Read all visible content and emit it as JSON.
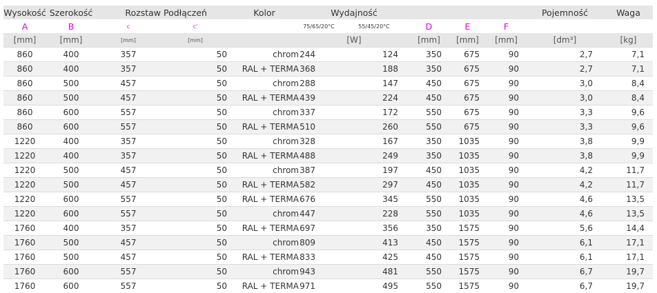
{
  "headers": {
    "row1": {
      "wysokosc": "Wysokość",
      "szerokosc": "Szerokość",
      "rozstaw": "Rozstaw",
      "podlaczen": "Podłączeń",
      "kolor": "Kolor",
      "wydajnosc": "Wydajność",
      "pojemnosc": "Pojemność",
      "waga": "Waga"
    },
    "row2": {
      "a": "A",
      "b": "B",
      "c": "c",
      "c2": "c'",
      "t1": "75/65/20°C",
      "t2": "55/45/20°C",
      "d": "D",
      "e": "E",
      "f": "F"
    },
    "row3": {
      "a": "[mm]",
      "b": "[mm]",
      "c": "[mm]",
      "c2": "[mm]",
      "w": "[W]",
      "d": "[mm]",
      "e": "[mm]",
      "f": "[mm]",
      "poj": "[dm³]",
      "waga": "[kg]"
    }
  },
  "columns": [
    "A",
    "B",
    "C",
    "C'",
    "Kolor",
    "75/65/20°C",
    "55/45/20°C",
    "D",
    "E",
    "F",
    "Pojemność",
    "Waga"
  ],
  "rows": [
    [
      "860",
      "400",
      "357",
      "50",
      "chrom",
      "244",
      "124",
      "350",
      "675",
      "90",
      "2,7",
      "7,1"
    ],
    [
      "860",
      "400",
      "357",
      "50",
      "RAL + TERMA",
      "368",
      "188",
      "350",
      "675",
      "90",
      "2,7",
      "7,1"
    ],
    [
      "860",
      "500",
      "457",
      "50",
      "chrom",
      "288",
      "147",
      "450",
      "675",
      "90",
      "3,0",
      "8,4"
    ],
    [
      "860",
      "500",
      "457",
      "50",
      "RAL + TERMA",
      "439",
      "224",
      "450",
      "675",
      "90",
      "3,0",
      "8,4"
    ],
    [
      "860",
      "600",
      "557",
      "50",
      "chrom",
      "337",
      "172",
      "550",
      "675",
      "90",
      "3,3",
      "9,6"
    ],
    [
      "860",
      "600",
      "557",
      "50",
      "RAL + TERMA",
      "510",
      "260",
      "550",
      "675",
      "90",
      "3,3",
      "9,6"
    ],
    [
      "1220",
      "400",
      "357",
      "50",
      "chrom",
      "328",
      "167",
      "350",
      "1035",
      "90",
      "3,8",
      "9,9"
    ],
    [
      "1220",
      "400",
      "357",
      "50",
      "RAL + TERMA",
      "488",
      "249",
      "350",
      "1035",
      "90",
      "3,8",
      "9,9"
    ],
    [
      "1220",
      "500",
      "457",
      "50",
      "chrom",
      "387",
      "197",
      "450",
      "1035",
      "90",
      "4,2",
      "11,7"
    ],
    [
      "1220",
      "500",
      "457",
      "50",
      "RAL + TERMA",
      "582",
      "297",
      "450",
      "1035",
      "90",
      "4,2",
      "11,7"
    ],
    [
      "1220",
      "600",
      "557",
      "50",
      "RAL + TERMA",
      "676",
      "345",
      "550",
      "1035",
      "90",
      "4,6",
      "13,5"
    ],
    [
      "1220",
      "600",
      "557",
      "50",
      "chrom",
      "447",
      "228",
      "550",
      "1035",
      "90",
      "4,6",
      "13,5"
    ],
    [
      "1760",
      "400",
      "357",
      "50",
      "RAL + TERMA",
      "697",
      "356",
      "350",
      "1575",
      "90",
      "5,6",
      "14,4"
    ],
    [
      "1760",
      "500",
      "457",
      "50",
      "chrom",
      "809",
      "413",
      "450",
      "1575",
      "90",
      "6,1",
      "17,1"
    ],
    [
      "1760",
      "500",
      "457",
      "50",
      "RAL + TERMA",
      "833",
      "425",
      "450",
      "1575",
      "90",
      "6,1",
      "17,1"
    ],
    [
      "1760",
      "600",
      "557",
      "50",
      "chrom",
      "943",
      "481",
      "550",
      "1575",
      "90",
      "6,7",
      "19,7"
    ],
    [
      "1760",
      "600",
      "557",
      "50",
      "RAL + TERMA",
      "971",
      "495",
      "550",
      "1575",
      "90",
      "6,7",
      "19,7"
    ]
  ],
  "colors": {
    "header_bg": "#e6e6e6",
    "letter_color": "#e000e0",
    "stripe_bg": "#f1f1f1",
    "text": "#333333"
  }
}
